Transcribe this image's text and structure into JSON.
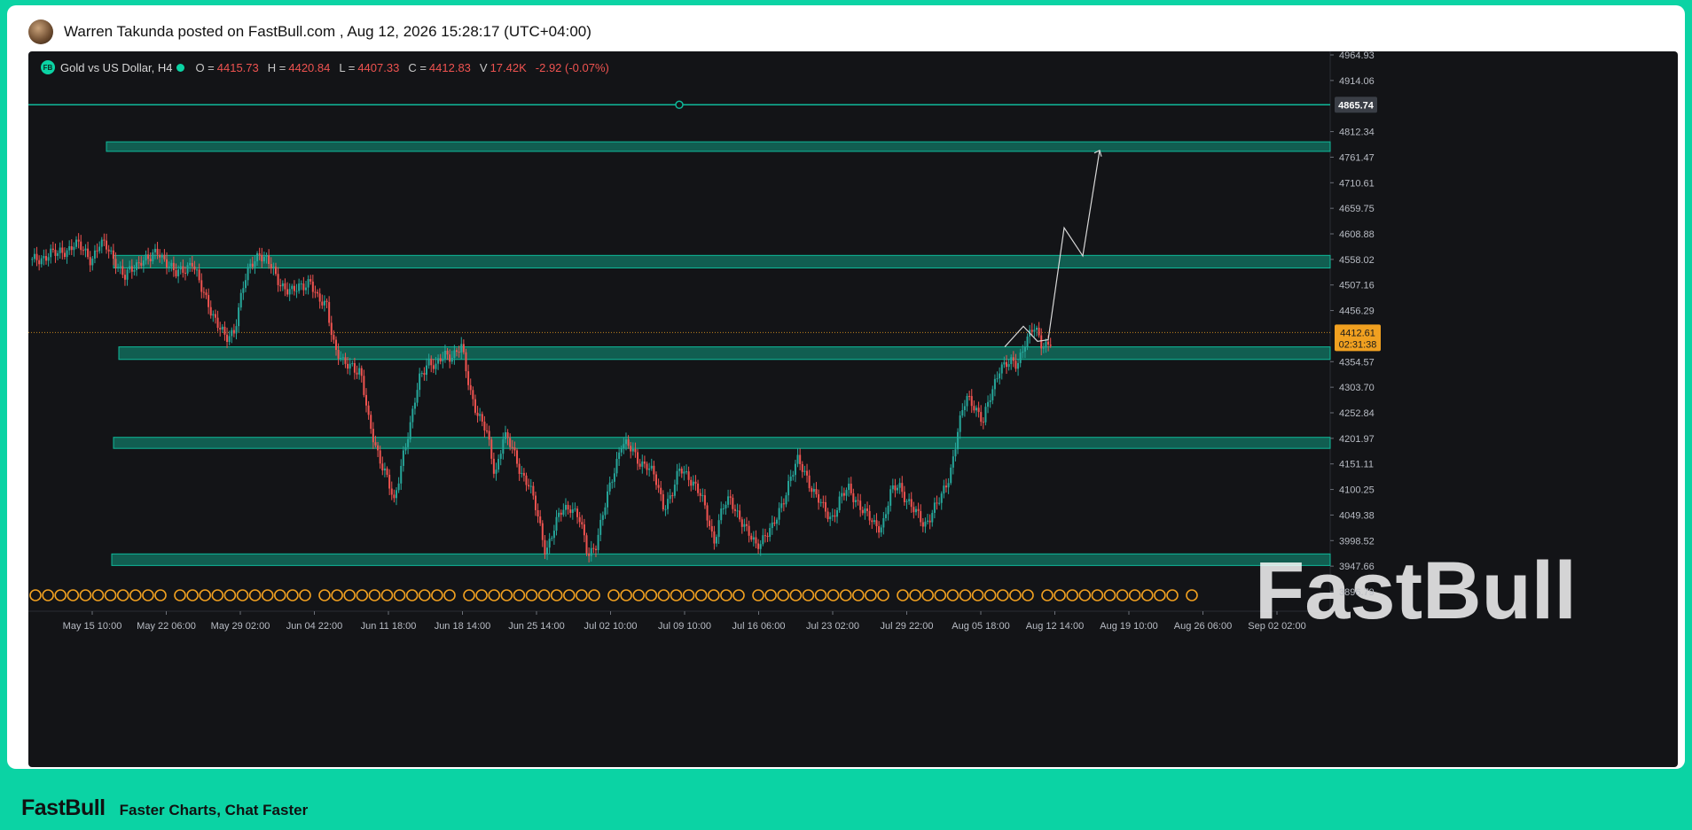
{
  "post": {
    "text": "Warren Takunda posted on FastBull.com ,  Aug 12, 2026 15:28:17 (UTC+04:00)"
  },
  "legend": {
    "badge": "FB",
    "symbol": "Gold vs US Dollar, H4",
    "o_label": "O =",
    "o_value": "4415.73",
    "h_label": "H =",
    "h_value": "4420.84",
    "l_label": "L =",
    "l_value": "4407.33",
    "c_label": "C =",
    "c_value": "4412.83",
    "v_label": "V",
    "v_value": "17.42K",
    "change": "-2.92 (-0.07%)"
  },
  "watermark": "FastBull",
  "footer": {
    "brand": "FastBull",
    "tagline": "Faster Charts, Chat Faster"
  },
  "colors": {
    "up": "#26a69a",
    "down": "#ef5350",
    "zone": "#0fb99a",
    "price_tag": "#f0a020",
    "event_marker": "#f0a020"
  },
  "chart_data": {
    "type": "candlestick",
    "title": "Gold vs US Dollar, H4",
    "timeframe": "H4",
    "y_ticks": [
      4964.93,
      4914.06,
      4812.34,
      4761.47,
      4710.61,
      4659.75,
      4608.88,
      4558.02,
      4507.16,
      4456.29,
      4354.57,
      4303.7,
      4252.84,
      4201.97,
      4151.11,
      4100.25,
      4049.38,
      3998.52,
      3947.66,
      3896.79
    ],
    "y_tick_labels": [
      "4964.93",
      "4914.06",
      "4812.34",
      "4761.47",
      "4710.61",
      "4659.75",
      "4608.88",
      "4558.02",
      "4507.16",
      "4456.29",
      "4354.57",
      "4303.70",
      "4252.84",
      "4201.97",
      "4151.11",
      "4100.25",
      "4049.38",
      "3998.52",
      "3947.66",
      "3896.79"
    ],
    "x_ticks": [
      "May 15 10:00",
      "May 22 06:00",
      "May 29 02:00",
      "Jun 04 22:00",
      "Jun 11 18:00",
      "Jun 18 14:00",
      "Jun 25 14:00",
      "Jul 02 10:00",
      "Jul 09 10:00",
      "Jul 16 06:00",
      "Jul 23 02:00",
      "Jul 29 22:00",
      "Aug 05 18:00",
      "Aug 12 14:00",
      "Aug 19 10:00",
      "Aug 26 06:00",
      "Sep 02 02:00"
    ],
    "ylim": [
      3860,
      5000
    ],
    "last_price": {
      "price": "4412.61",
      "countdown": "02:31:38",
      "value": 4412.61
    },
    "horizontal_line": {
      "label": "4865.74",
      "value": 4865.74
    },
    "zones": [
      {
        "low": 4773,
        "high": 4792
      },
      {
        "low": 4541,
        "high": 4566
      },
      {
        "low": 4359,
        "high": 4384
      },
      {
        "low": 4182,
        "high": 4204
      },
      {
        "low": 3949,
        "high": 3972
      }
    ],
    "price_path": [
      [
        4552,
        4760
      ],
      [
        4560,
        4740
      ],
      [
        4572,
        4718
      ],
      [
        4565,
        4740
      ],
      [
        4578,
        4705
      ],
      [
        4590,
        4690
      ],
      [
        4575,
        4700
      ],
      [
        4560,
        4660
      ],
      [
        4588,
        4585
      ],
      [
        4578,
        4540
      ],
      [
        4555,
        4570
      ],
      [
        4520,
        4572
      ],
      [
        4540,
        4540
      ],
      [
        4562,
        4566
      ],
      [
        4555,
        4520
      ],
      [
        4575,
        4500
      ],
      [
        4555,
        4540
      ],
      [
        4525,
        4580
      ],
      [
        4540,
        4590
      ],
      [
        4555,
        4560
      ],
      [
        4500,
        4545
      ],
      [
        4470,
        4525
      ],
      [
        4430,
        4475
      ],
      [
        4395,
        4400
      ],
      [
        4420,
        4460
      ],
      [
        4500,
        4500
      ],
      [
        4545,
        4545
      ],
      [
        4575,
        4580
      ],
      [
        4552,
        4530
      ],
      [
        4520,
        4530
      ],
      [
        4505,
        4480
      ],
      [
        4490,
        4495
      ],
      [
        4505,
        4480
      ],
      [
        4520,
        4510
      ],
      [
        4470,
        4495
      ],
      [
        4470,
        4420
      ],
      [
        4380,
        4350
      ],
      [
        4345,
        4380
      ],
      [
        4350,
        4375
      ],
      [
        4335,
        4300
      ],
      [
        4230,
        4280
      ],
      [
        4180,
        4150
      ],
      [
        4130,
        4080
      ],
      [
        4070,
        4150
      ],
      [
        4170,
        4200
      ],
      [
        4230,
        4240
      ],
      [
        4320,
        4300
      ],
      [
        4360,
        4345
      ],
      [
        4340,
        4355
      ],
      [
        4370,
        4350
      ],
      [
        4370,
        4360
      ],
      [
        4380,
        4345
      ],
      [
        4300,
        4265
      ],
      [
        4250,
        4220
      ],
      [
        4210,
        4155
      ],
      [
        4130,
        4175
      ],
      [
        4210,
        4200
      ],
      [
        4180,
        4150
      ],
      [
        4140,
        4120
      ],
      [
        4110,
        4090
      ],
      [
        4050,
        4020
      ],
      [
        3980,
        3990
      ],
      [
        4020,
        4040
      ],
      [
        4060,
        4085
      ],
      [
        4070,
        4060
      ],
      [
        4040,
        4010
      ],
      [
        3970,
        3960
      ],
      [
        3995,
        4040
      ],
      [
        4060,
        4090
      ],
      [
        4130,
        4140
      ],
      [
        4195,
        4190
      ],
      [
        4180,
        4165
      ],
      [
        4160,
        4140
      ],
      [
        4150,
        4120
      ],
      [
        4120,
        4080
      ],
      [
        4070,
        4050
      ],
      [
        4090,
        4125
      ],
      [
        4140,
        4135
      ],
      [
        4130,
        4110
      ],
      [
        4100,
        4080
      ],
      [
        4060,
        4010
      ],
      [
        4000,
        4030
      ],
      [
        4060,
        4080
      ],
      [
        4080,
        4060
      ],
      [
        4050,
        4030
      ],
      [
        4010,
        3985
      ],
      [
        3990,
        4000
      ],
      [
        4010,
        4020
      ],
      [
        4020,
        4050
      ],
      [
        4070,
        4110
      ],
      [
        4120,
        4150
      ],
      [
        4155,
        4140
      ],
      [
        4130,
        4110
      ],
      [
        4090,
        4050
      ],
      [
        4060,
        4045
      ],
      [
        4045,
        4060
      ],
      [
        4080,
        4110
      ],
      [
        4100,
        4090
      ],
      [
        4080,
        4060
      ],
      [
        4050,
        4035
      ],
      [
        4030,
        4020
      ],
      [
        4030,
        4060
      ],
      [
        4090,
        4120
      ],
      [
        4110,
        4090
      ],
      [
        4080,
        4060
      ],
      [
        4050,
        4040
      ],
      [
        4030,
        4045
      ],
      [
        4060,
        4065
      ],
      [
        4080,
        4100
      ],
      [
        4130,
        4180
      ],
      [
        4220,
        4250
      ],
      [
        4280,
        4300
      ],
      [
        4270,
        4240
      ],
      [
        4235,
        4260
      ],
      [
        4290,
        4320
      ],
      [
        4350,
        4370
      ],
      [
        4350,
        4340
      ],
      [
        4345,
        4370
      ],
      [
        4400,
        4430
      ],
      [
        4420,
        4380
      ],
      [
        4385,
        4395
      ],
      [
        4400,
        4412.61
      ]
    ],
    "events": 94
  }
}
